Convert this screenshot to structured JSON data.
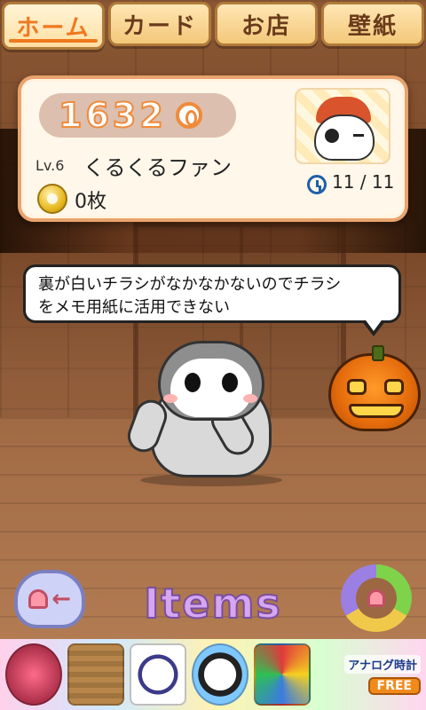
{
  "tabs": [
    {
      "label": "ホーム",
      "active": true
    },
    {
      "label": "カード",
      "active": false
    },
    {
      "label": "お店",
      "active": false
    },
    {
      "label": "壁紙",
      "active": false
    }
  ],
  "status": {
    "coins": "1632",
    "level": "Lv.6",
    "name": "くるくるファン",
    "medals": "0枚",
    "clock": "11 / 11"
  },
  "speech": {
    "line1": "裏が白いチラシがなかなかないのでチラシ",
    "line2": "をメモ用紙に活用できない"
  },
  "controls": {
    "items_label": "Items"
  },
  "ad": {
    "title": "アナログ時計",
    "badge": "FREE"
  },
  "colors": {
    "accent": "#f07820",
    "panel_border": "#e9a36d",
    "items_text": "#d6a6f2"
  }
}
